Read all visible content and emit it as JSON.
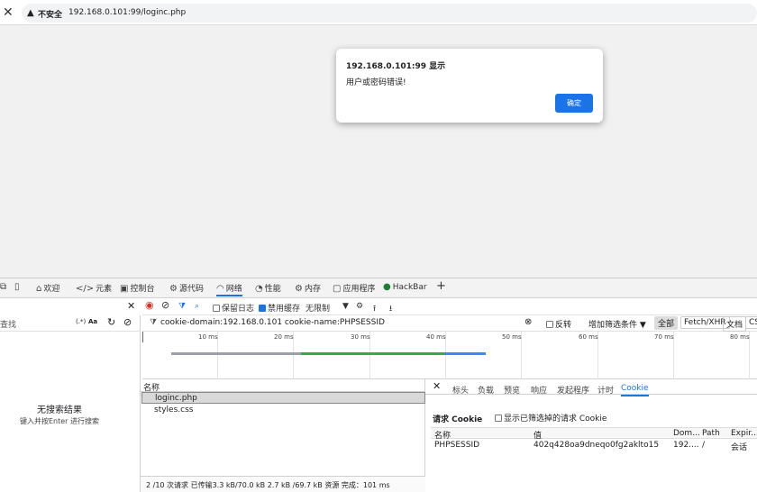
{
  "addressbar": {
    "close_glyph": "✕",
    "warning_icon": "warning-triangle-icon",
    "warning_glyph": "▲",
    "security_label": "不安全",
    "url": "192.168.0.101:99/loginc.php"
  },
  "dialog": {
    "title": "192.168.0.101:99 显示",
    "message": "用户或密码错误!",
    "ok_label": "确定"
  },
  "devtools": {
    "tabs": [
      {
        "label": "欢迎",
        "icon": "⌂"
      },
      {
        "label": "元素",
        "icon": "</>"
      },
      {
        "label": "控制台",
        "icon": "▣"
      },
      {
        "label": "源代码",
        "icon": "⚙"
      },
      {
        "label": "网络",
        "icon": "◠"
      },
      {
        "label": "性能",
        "icon": "◔"
      },
      {
        "label": "内存",
        "icon": "⚙"
      },
      {
        "label": "应用程序",
        "icon": "▢"
      },
      {
        "label": "HackBar",
        "icon": "●"
      }
    ],
    "add_tab": "+",
    "toolbar": {
      "preserve_log": "保留日志",
      "preserve_log_checked": false,
      "disable_cache": "禁用缓存",
      "disable_cache_checked": true,
      "throttle": "无限制"
    },
    "search": {
      "placeholder": "查找",
      "case_label": "Aa",
      "regex_label": "(.*)",
      "no_results": "无搜索结果",
      "hint": "键入并按Enter 进行搜索"
    },
    "filter": {
      "value": "cookie-domain:192.168.0.101 cookie-name:PHPSESSID",
      "invert_label": "反转",
      "more_filters": "增加筛选条件",
      "type_buttons": [
        "全部",
        "Fetch/XHR",
        "文档",
        "CS"
      ]
    },
    "timeline": {
      "ticks": [
        "10 ms",
        "20 ms",
        "30 ms",
        "40 ms",
        "50 ms",
        "60 ms",
        "70 ms",
        "80 ms"
      ]
    },
    "requests": {
      "header": "名称",
      "rows": [
        "loginc.php",
        "styles.css"
      ]
    },
    "status": {
      "text": "2 /10 次请求   已传输3.3 kB/70.0 kB   2.7 kB /69.7 kB 资源   完成：101 ms"
    },
    "details": {
      "tabs": [
        "标头",
        "负载",
        "预览",
        "响应",
        "发起程序",
        "计时",
        "Cookie"
      ],
      "active_tab": "Cookie",
      "section_title": "请求 Cookie",
      "show_filtered": "显示已筛选掉的请求 Cookie",
      "columns": [
        "名称",
        "值",
        "Dom...",
        "Path",
        "Expir..."
      ],
      "rows": [
        [
          "PHPSESSID",
          "402q428oa9dneqo0fg2aklto15",
          "192....",
          "/",
          "会话"
        ]
      ]
    }
  },
  "colors": {
    "accent": "#1a73e8",
    "record": "#d93025",
    "timeline_gray": "#9aa0a6",
    "timeline_green": "#34a853",
    "timeline_blue": "#4285f4"
  }
}
